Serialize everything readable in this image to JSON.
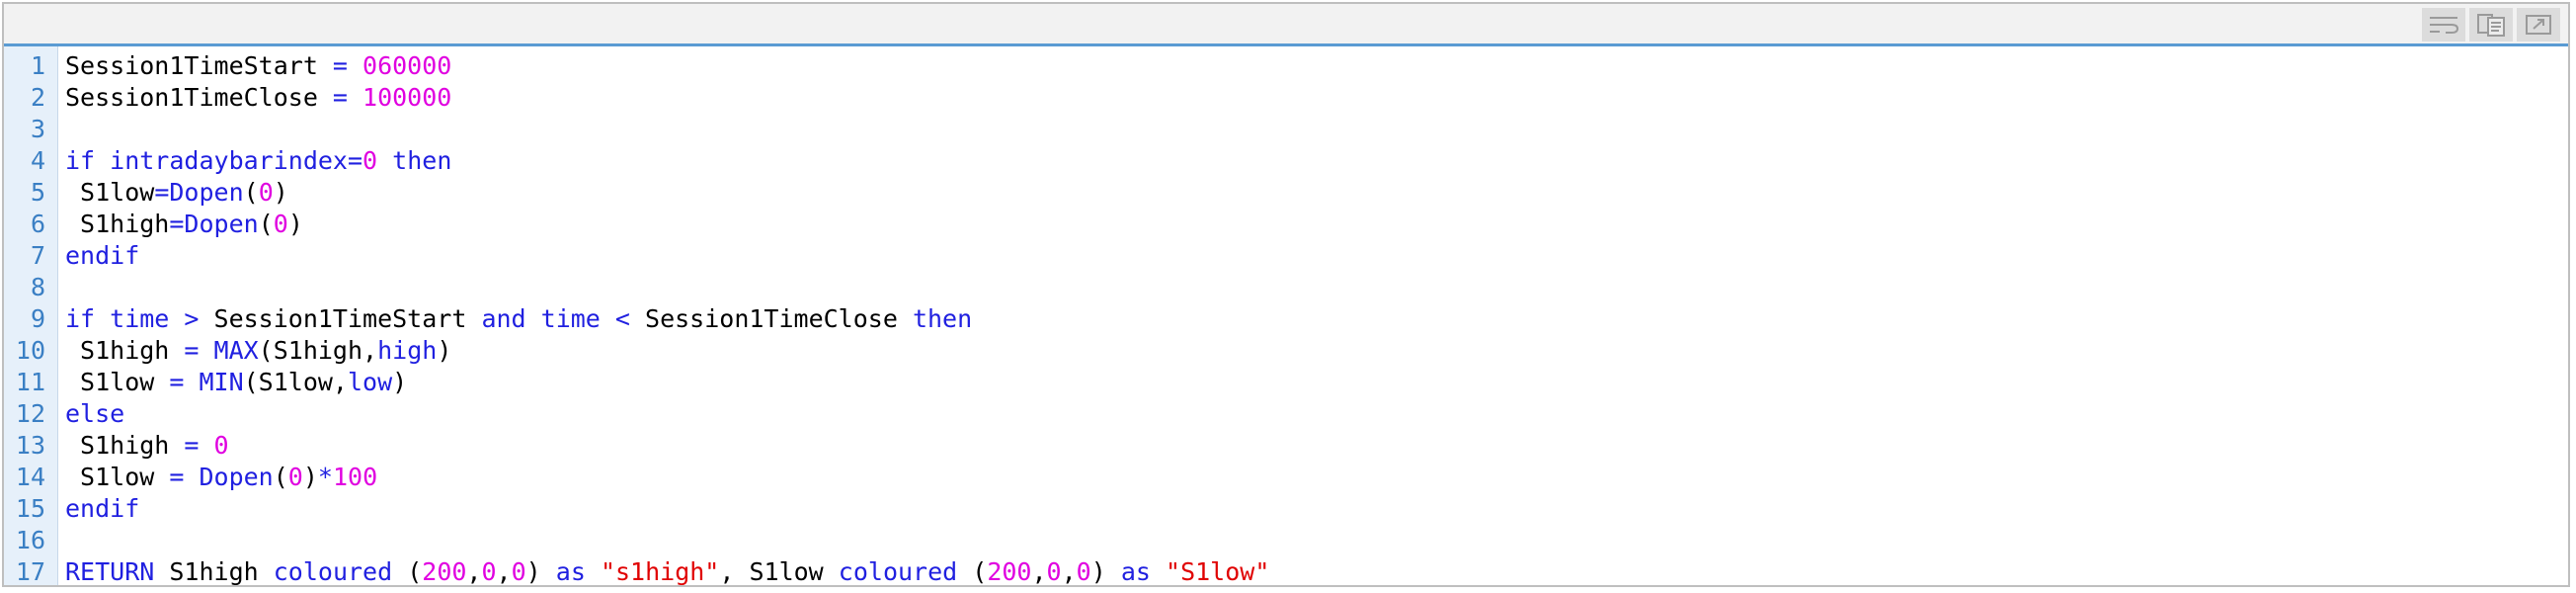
{
  "toolbar": {
    "icons": [
      "wrap-lines-icon",
      "copy-code-icon",
      "open-popup-icon"
    ]
  },
  "colors": {
    "keyword": "#2020e0",
    "number": "#e000e0",
    "string": "#e00000",
    "plain": "#000000",
    "line_number": "#3a7fc4",
    "gutter_bg": "#e6f0fa",
    "toolbar_accent": "#5a9bd3"
  },
  "code": {
    "lines": [
      {
        "n": "1",
        "tokens": [
          [
            "var",
            "Session1TimeStart"
          ],
          [
            "op",
            " = "
          ],
          [
            "num",
            "060000"
          ]
        ]
      },
      {
        "n": "2",
        "tokens": [
          [
            "var",
            "Session1TimeClose"
          ],
          [
            "op",
            " = "
          ],
          [
            "num",
            "100000"
          ]
        ]
      },
      {
        "n": "3",
        "tokens": []
      },
      {
        "n": "4",
        "tokens": [
          [
            "kw",
            "if intradaybarindex"
          ],
          [
            "op",
            "="
          ],
          [
            "num",
            "0"
          ],
          [
            "kw",
            " then"
          ]
        ]
      },
      {
        "n": "5",
        "tokens": [
          [
            "var",
            " S1low"
          ],
          [
            "op",
            "="
          ],
          [
            "kw",
            "Dopen"
          ],
          [
            "var",
            "("
          ],
          [
            "num",
            "0"
          ],
          [
            "var",
            ")"
          ]
        ]
      },
      {
        "n": "6",
        "tokens": [
          [
            "var",
            " S1high"
          ],
          [
            "op",
            "="
          ],
          [
            "kw",
            "Dopen"
          ],
          [
            "var",
            "("
          ],
          [
            "num",
            "0"
          ],
          [
            "var",
            ")"
          ]
        ]
      },
      {
        "n": "7",
        "tokens": [
          [
            "kw",
            "endif"
          ]
        ]
      },
      {
        "n": "8",
        "tokens": []
      },
      {
        "n": "9",
        "tokens": [
          [
            "kw",
            "if time"
          ],
          [
            "op",
            " > "
          ],
          [
            "var",
            "Session1TimeStart"
          ],
          [
            "kw",
            " and time"
          ],
          [
            "op",
            " < "
          ],
          [
            "var",
            "Session1TimeClose"
          ],
          [
            "kw",
            " then"
          ]
        ]
      },
      {
        "n": "10",
        "tokens": [
          [
            "var",
            " S1high"
          ],
          [
            "op",
            " = "
          ],
          [
            "kw",
            "MAX"
          ],
          [
            "var",
            "(S1high,"
          ],
          [
            "kw",
            "high"
          ],
          [
            "var",
            ")"
          ]
        ]
      },
      {
        "n": "11",
        "tokens": [
          [
            "var",
            " S1low"
          ],
          [
            "op",
            " = "
          ],
          [
            "kw",
            "MIN"
          ],
          [
            "var",
            "(S1low,"
          ],
          [
            "kw",
            "low"
          ],
          [
            "var",
            ")"
          ]
        ]
      },
      {
        "n": "12",
        "tokens": [
          [
            "kw",
            "else"
          ]
        ]
      },
      {
        "n": "13",
        "tokens": [
          [
            "var",
            " S1high"
          ],
          [
            "op",
            " = "
          ],
          [
            "num",
            "0"
          ]
        ]
      },
      {
        "n": "14",
        "tokens": [
          [
            "var",
            " S1low"
          ],
          [
            "op",
            " = "
          ],
          [
            "kw",
            "Dopen"
          ],
          [
            "var",
            "("
          ],
          [
            "num",
            "0"
          ],
          [
            "var",
            ")"
          ],
          [
            "op",
            "*"
          ],
          [
            "num",
            "100"
          ]
        ]
      },
      {
        "n": "15",
        "tokens": [
          [
            "kw",
            "endif"
          ]
        ]
      },
      {
        "n": "16",
        "tokens": []
      },
      {
        "n": "17",
        "tokens": [
          [
            "kw",
            "RETURN"
          ],
          [
            "var",
            " S1high "
          ],
          [
            "kw",
            "coloured"
          ],
          [
            "var",
            " ("
          ],
          [
            "num",
            "200"
          ],
          [
            "var",
            ","
          ],
          [
            "num",
            "0"
          ],
          [
            "var",
            ","
          ],
          [
            "num",
            "0"
          ],
          [
            "var",
            ") "
          ],
          [
            "kw",
            "as"
          ],
          [
            "var",
            " "
          ],
          [
            "str",
            "\"s1high\""
          ],
          [
            "var",
            ", S1low "
          ],
          [
            "kw",
            "coloured"
          ],
          [
            "var",
            " ("
          ],
          [
            "num",
            "200"
          ],
          [
            "var",
            ","
          ],
          [
            "num",
            "0"
          ],
          [
            "var",
            ","
          ],
          [
            "num",
            "0"
          ],
          [
            "var",
            ") "
          ],
          [
            "kw",
            "as"
          ],
          [
            "var",
            " "
          ],
          [
            "str",
            "\"S1low\""
          ]
        ]
      }
    ]
  }
}
